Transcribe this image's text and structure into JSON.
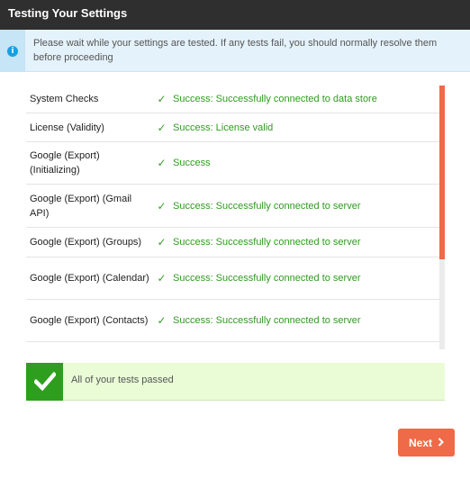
{
  "header": {
    "title": "Testing Your Settings"
  },
  "info": {
    "icon": "info-icon",
    "icon_glyph": "i",
    "message": "Please wait while your settings are tested. If any tests fail, you should normally resolve them before proceeding"
  },
  "tests": [
    {
      "name": "System Checks",
      "status": "Success: Successfully connected to data store"
    },
    {
      "name": "License (Validity)",
      "status": "Success: License valid"
    },
    {
      "name": "Google (Export) (Initializing)",
      "status": "Success"
    },
    {
      "name": "Google (Export) (Gmail API)",
      "status": "Success: Successfully connected to server"
    },
    {
      "name": "Google (Export) (Groups)",
      "status": "Success: Successfully connected to server"
    },
    {
      "name": "Google (Export) (Calendar)",
      "status": "Success: Successfully connected to server"
    },
    {
      "name": "Google (Export) (Contacts)",
      "status": "Success: Successfully connected to server"
    }
  ],
  "check_glyph": "✓",
  "result": {
    "message": "All of your tests passed",
    "icon": "checkmark-icon"
  },
  "footer": {
    "next_label": "Next",
    "next_icon": "chevron-right-icon"
  },
  "colors": {
    "accent": "#ef6a48",
    "success": "#2f9b1f",
    "success_box": "#2e9e1e",
    "info_bg": "#e4f2fb",
    "titlebar": "#2f2f2f"
  }
}
